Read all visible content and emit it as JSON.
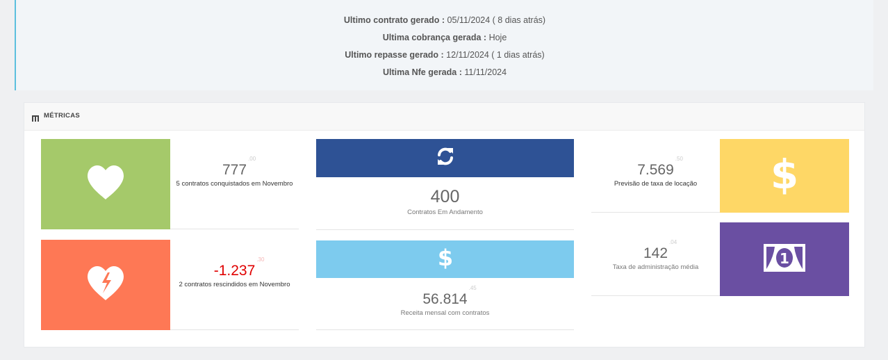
{
  "info": {
    "lines": [
      {
        "label": "Ultimo contrato gerado :",
        "value": "05/11/2024 ( 8 dias atrás)"
      },
      {
        "label": "Ultima cobrança gerada :",
        "value": "Hoje"
      },
      {
        "label": "Ultimo repasse gerado :",
        "value": "12/11/2024 ( 1 dias atrás)"
      },
      {
        "label": "Ultima Nfe gerada :",
        "value": "11/11/2024"
      }
    ]
  },
  "metrics": {
    "title": "MÉTRICAS",
    "icon": "grid-icon",
    "tiles": {
      "conquistados": {
        "value": "777",
        "decimal": ".00",
        "label": "5 contratos conquistados em Novembro",
        "icon": "heart-icon",
        "color": "#a5c96a"
      },
      "rescindidos": {
        "value": "-1.237",
        "decimal": ".30",
        "label": "2 contratos rescindidos em Novembro",
        "icon": "broken-heart-icon",
        "color": "#fe7855"
      },
      "andamento": {
        "value": "400",
        "label": "Contratos Em Andamento",
        "icon": "refresh-icon",
        "color": "#2e5295"
      },
      "receita": {
        "value": "56.814",
        "decimal": ".45",
        "label": "Receita mensal com contratos",
        "icon": "dollar-icon",
        "color": "#7dcbee"
      },
      "previsao": {
        "value": "7.569",
        "decimal": ".50",
        "label": "Previsão de taxa de locação",
        "icon": "dollar-icon",
        "color": "#fed766"
      },
      "administracao": {
        "value": "142",
        "decimal": ".04",
        "label": "Taxa de administração média",
        "icon": "banknote-icon",
        "color": "#6a4fa2"
      }
    }
  }
}
